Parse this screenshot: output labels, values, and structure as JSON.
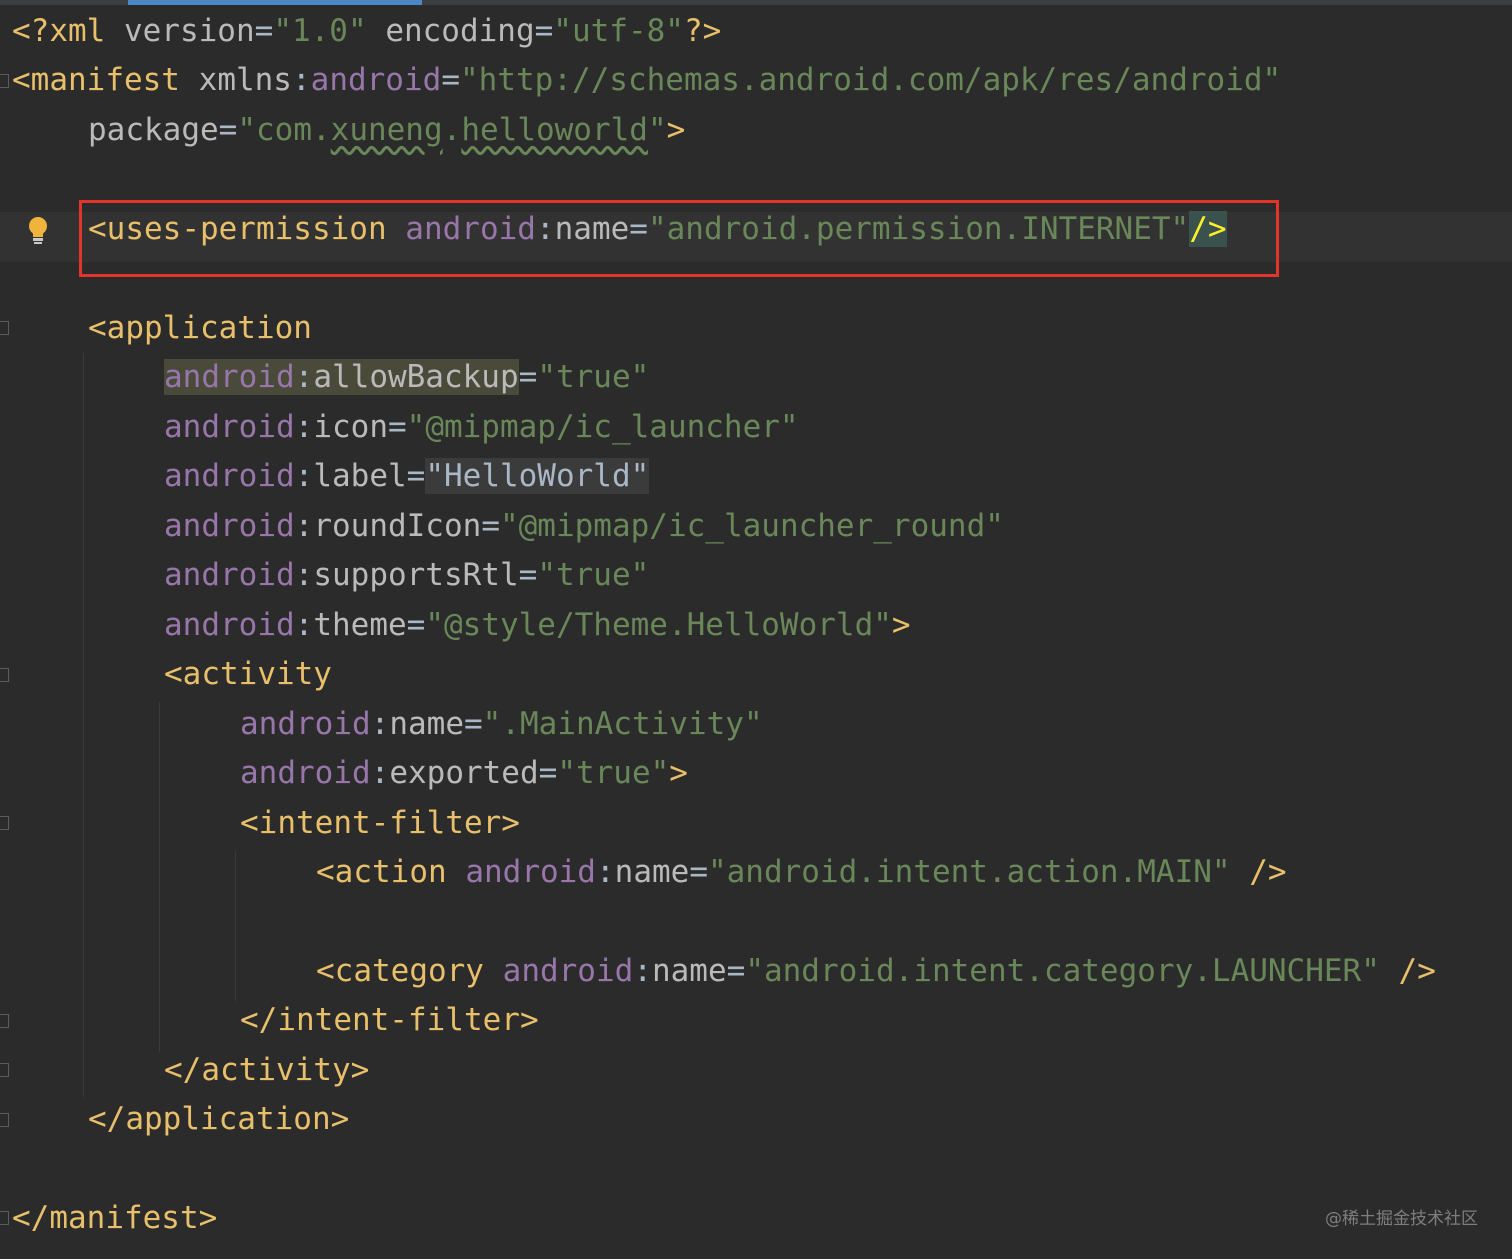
{
  "editor": {
    "file_content": {
      "xml_decl": {
        "open": "<?xml ",
        "version_attr": "version",
        "version_val": "\"1.0\"",
        "encoding_attr": "encoding",
        "encoding_val": "\"utf-8\"",
        "close": "?>"
      },
      "manifest_open": {
        "tag": "<manifest",
        "xmlns_attr": "xmlns",
        "ns_android": "android",
        "xmlns_val": "\"http://schemas.android.com/apk/res/android\""
      },
      "package": {
        "attr": "package",
        "val_prefix": "\"com.",
        "val_mid1": "xuneng",
        "dot": ".",
        "val_mid2": "helloworld",
        "val_suffix": "\"",
        "close": ">"
      },
      "uses_permission": {
        "tag": "<uses-permission",
        "ns": "android",
        "attr": "name",
        "val": "\"android.permission.INTERNET\"",
        "close": "/>"
      },
      "application_open": {
        "tag": "<application"
      },
      "app_attrs": [
        {
          "ns": "android",
          "attr": "allowBackup",
          "val": "\"true\"",
          "close": ""
        },
        {
          "ns": "android",
          "attr": "icon",
          "val": "\"@mipmap/ic_launcher\"",
          "close": ""
        },
        {
          "ns": "android",
          "attr": "label",
          "val": "\"HelloWorld\"",
          "close": ""
        },
        {
          "ns": "android",
          "attr": "roundIcon",
          "val": "\"@mipmap/ic_launcher_round\"",
          "close": ""
        },
        {
          "ns": "android",
          "attr": "supportsRtl",
          "val": "\"true\"",
          "close": ""
        },
        {
          "ns": "android",
          "attr": "theme",
          "val": "\"@style/Theme.HelloWorld\"",
          "close": ">"
        }
      ],
      "activity_open": {
        "tag": "<activity"
      },
      "activity_attrs": [
        {
          "ns": "android",
          "attr": "name",
          "val": "\".MainActivity\"",
          "close": ""
        },
        {
          "ns": "android",
          "attr": "exported",
          "val": "\"true\"",
          "close": ">"
        }
      ],
      "intent_filter_open": "<intent-filter>",
      "action": {
        "tag": "<action",
        "ns": "android",
        "attr": "name",
        "val": "\"android.intent.action.MAIN\"",
        "close": " />"
      },
      "category": {
        "tag": "<category",
        "ns": "android",
        "attr": "name",
        "val": "\"android.intent.category.LAUNCHER\"",
        "close": " />"
      },
      "intent_filter_close": "</intent-filter>",
      "activity_close": "</activity>",
      "application_close": "</application>",
      "manifest_close": "</manifest>"
    },
    "gutter_icon": "lightbulb-icon"
  },
  "watermark": "@稀土掘金技术社区",
  "colors": {
    "background": "#2b2b2b",
    "tag": "#e8bf6a",
    "namespace": "#9876aa",
    "attribute": "#bababa",
    "string": "#6a8759",
    "highlight_box": "#e3342c"
  }
}
